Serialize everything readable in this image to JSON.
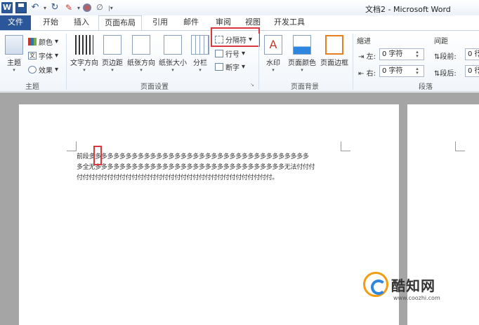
{
  "window": {
    "title": "文档2 - Microsoft Word"
  },
  "qat": {
    "icons": [
      "word-logo-icon",
      "save-icon",
      "undo-icon",
      "redo-icon",
      "format-painter-icon",
      "color-icon",
      "draw-icon"
    ]
  },
  "tabs": [
    "文件",
    "开始",
    "插入",
    "页面布局",
    "引用",
    "邮件",
    "审阅",
    "视图",
    "开发工具"
  ],
  "ribbon": {
    "theme": {
      "label": "主题",
      "colors": "颜色",
      "fonts": "字体",
      "effects": "效果",
      "group": "主题"
    },
    "page_setup": {
      "text_direction": "文字方向",
      "margins": "页边距",
      "orientation": "纸张方向",
      "size": "纸张大小",
      "columns": "分栏",
      "breaks": "分隔符",
      "line_numbers": "行号",
      "hyphenation": "断字",
      "group": "页面设置"
    },
    "page_background": {
      "watermark": "水印",
      "page_color": "页面颜色",
      "page_borders": "页面边框",
      "group": "页面背景"
    },
    "paragraph": {
      "indent": "缩进",
      "left": "左:",
      "left_value": "0 字符",
      "right": "右:",
      "right_value": "0 字符",
      "spacing": "间距",
      "before": "段前:",
      "before_value": "0 行",
      "after": "段后:",
      "after_value": "0 行",
      "group": "段落"
    }
  },
  "document": {
    "line1": "前段多多多多多多多多多多多多多多多多多多多多多多多多多多多多多多多多多多多多",
    "line2": "多全无多多多多多多多多多多多多多多多多多多多多多多多多多多多多多多多无法付付付",
    "line3": "付付付付付付付付付付付付付付付付付付付付付付付付付付付付付付付付。"
  },
  "watermark": {
    "brand": "酷知网",
    "url": "www.coozhi.com"
  },
  "colors": {
    "accent": "#2b579a",
    "highlight": "#d9363e"
  }
}
